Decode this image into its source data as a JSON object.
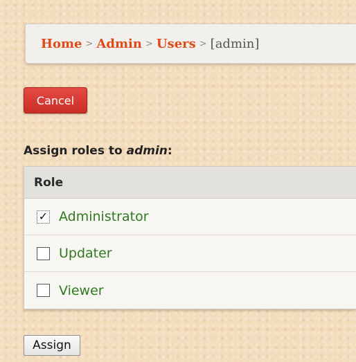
{
  "breadcrumb": {
    "home": "Home",
    "admin": "Admin",
    "users": "Users",
    "current": "[admin]",
    "separator": ">"
  },
  "cancel_button": {
    "label": "Cancel"
  },
  "assign_heading": {
    "prefix": "Assign roles to ",
    "username": "admin",
    "suffix": ":"
  },
  "roles_table": {
    "header": "Role",
    "rows": [
      {
        "label": "Administrator",
        "checked": true
      },
      {
        "label": "Updater",
        "checked": false
      },
      {
        "label": "Viewer",
        "checked": false
      }
    ]
  },
  "assign_button": {
    "label": "Assign"
  },
  "colors": {
    "link": "#e04a1a",
    "role_label": "#2f7a1f",
    "cancel_bg": "#d93a33",
    "page_bg": "#f3dcbc"
  }
}
